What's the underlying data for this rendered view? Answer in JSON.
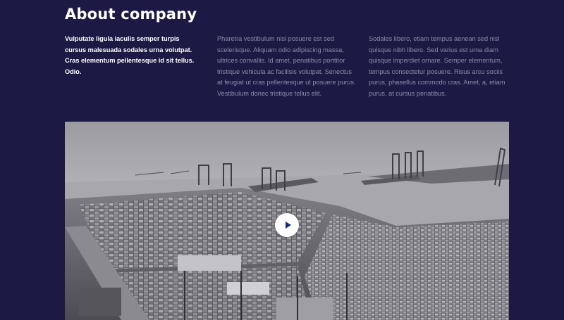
{
  "about": {
    "title": "About company",
    "col1": "Vulputate ligula iaculis semper turpis cursus malesuada sodales urna volutpat. Cras elementum pellentesque id sit tellus. Odio.",
    "col2": "Pharetra vestibulum nisl posuere est sed scelerisque. Aliquam odio adipiscing massa, ultrices convallis. Id amet, penatibus porttitor tristique vehicula ac facilisis volutpat. Senectus at feugiat ut cras pellentesque ut posuere purus. Vestibulum donec tristique tellus elit.",
    "col3": "Sodales libero, etiam tempus aenean sed nisl quisque nibh libero. Sed varius est urna diam quisque imperdiet ornare. Semper elementum, tempus consectetur posuere. Risus arcu sociis purus, phasellus commodo cras. Amet, a, etiam purus, at cursus penatibus."
  },
  "video": {
    "play_icon": "play-icon",
    "colors": {
      "background": "#1c1a45",
      "play_button": "#ffffff",
      "play_glyph": "#1c2a78"
    }
  }
}
